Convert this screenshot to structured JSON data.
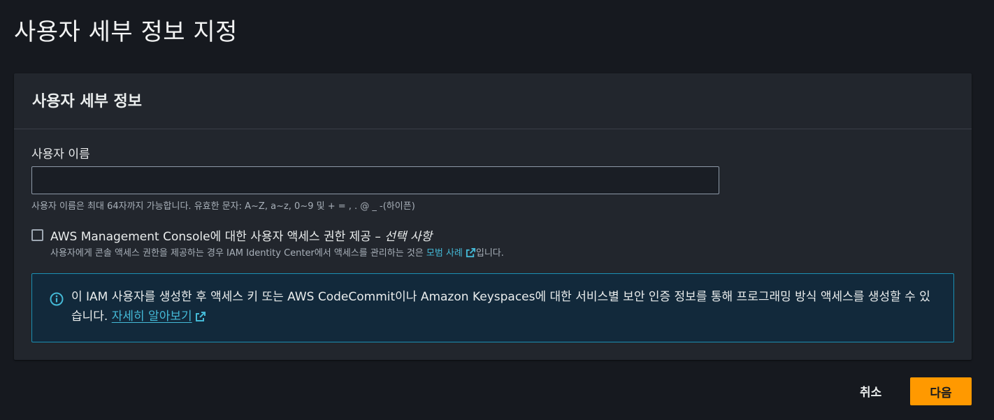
{
  "page": {
    "title": "사용자 세부 정보 지정"
  },
  "section": {
    "title": "사용자 세부 정보",
    "username_label": "사용자 이름",
    "username_value": "",
    "username_constraint": "사용자 이름은 최대 64자까지 가능합니다. 유효한 문자: A~Z, a~z, 0~9 및 + = , . @ _ -(하이픈)",
    "console_access": {
      "checked": false,
      "label": "AWS Management Console에 대한 사용자 액세스 권한 제공 –",
      "optional": "선택 사항",
      "description_prefix": "사용자에게 콘솔 액세스 권한을 제공하는 경우 IAM Identity Center에서 액세스를 관리하는 것은",
      "best_practice_link": "모범 사례",
      "description_suffix": "입니다."
    },
    "info_alert": {
      "text": "이 IAM 사용자를 생성한 후 액세스 키 또는 AWS CodeCommit이나 Amazon Keyspaces에 대한 서비스별 보안 인증 정보를 통해 프로그래밍 방식 액세스를 생성할 수 있습니다.",
      "learn_more_link": "자세히 알아보기"
    }
  },
  "footer": {
    "cancel_label": "취소",
    "next_label": "다음"
  },
  "colors": {
    "background": "#16191f",
    "panel": "#22262d",
    "link": "#44b9d6",
    "primary_button": "#ff9900",
    "info_border": "#1b8fb3",
    "info_background": "#12293b"
  },
  "icons": [
    "info-icon",
    "external-link-icon"
  ]
}
